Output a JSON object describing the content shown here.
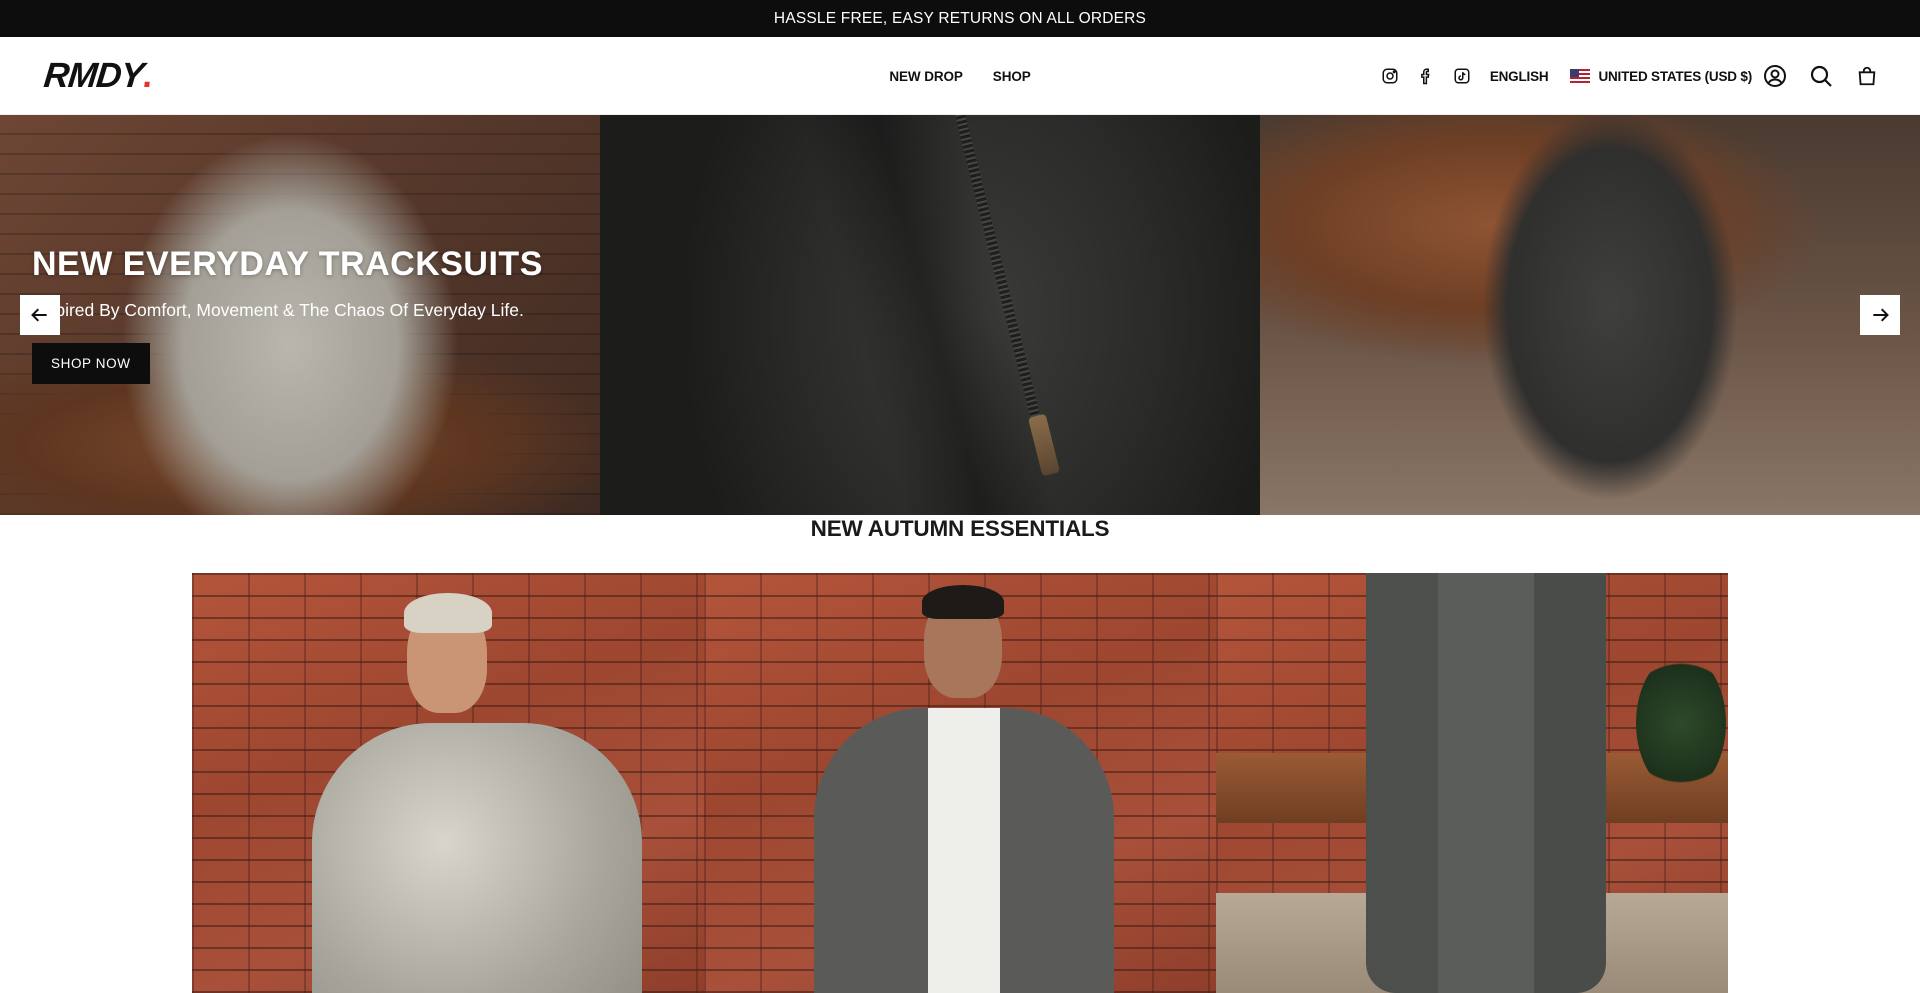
{
  "announcement": {
    "text": "HASSLE FREE, EASY RETURNS ON ALL ORDERS"
  },
  "header": {
    "logo": "RMDY",
    "logo_dot": ".",
    "nav": [
      {
        "label": "NEW DROP"
      },
      {
        "label": "SHOP"
      }
    ],
    "social_icons": [
      "instagram-icon",
      "facebook-icon",
      "tiktok-icon"
    ],
    "language": "ENGLISH",
    "country": "UNITED STATES (USD $)",
    "utility_icons": [
      "account-icon",
      "search-icon",
      "cart-icon"
    ]
  },
  "hero": {
    "title": "NEW EVERYDAY TRACKSUITS",
    "subtitle": "Inspired By Comfort, Movement & The Chaos Of Everyday Life.",
    "cta": "SHOP NOW",
    "prev_icon": "arrow-left-icon",
    "next_icon": "arrow-right-icon"
  },
  "collection": {
    "title": "NEW AUTUMN ESSENTIALS"
  },
  "colors": {
    "announcement_bg": "#0d0d0d",
    "logo_dot": "#e2352a",
    "button_bg": "#0d0d0d"
  }
}
